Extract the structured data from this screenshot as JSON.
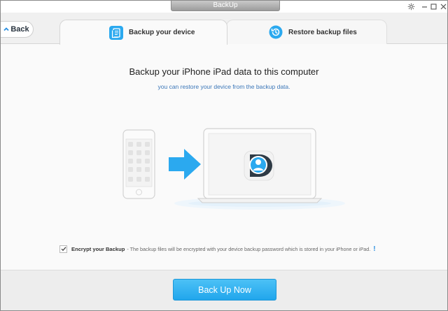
{
  "window": {
    "title": "BackUp"
  },
  "header": {
    "back_label": "Back",
    "tabs": [
      {
        "label": "Backup your device",
        "icon": "device-backup-icon",
        "active": true
      },
      {
        "label": "Restore backup files",
        "icon": "restore-clock-icon",
        "active": false
      }
    ]
  },
  "main": {
    "headline": "Backup your iPhone iPad data to this computer",
    "subline": "you can restore your device from the backup data.",
    "illustration": {
      "source_device": "phone-icon",
      "arrow": "arrow-right-icon",
      "target_device": "laptop-icon",
      "app_logo": "app-logo-icon"
    }
  },
  "encrypt": {
    "checked": true,
    "label": "Encrypt your Backup",
    "description": "- The backup files will be encrypted with your device backup password which is stored in your iPhone or iPad.",
    "info_glyph": "!"
  },
  "footer": {
    "primary_button": "Back Up Now"
  },
  "colors": {
    "accent": "#2ba9ef",
    "link_text": "#3a76b8",
    "background": "#fafafa"
  }
}
